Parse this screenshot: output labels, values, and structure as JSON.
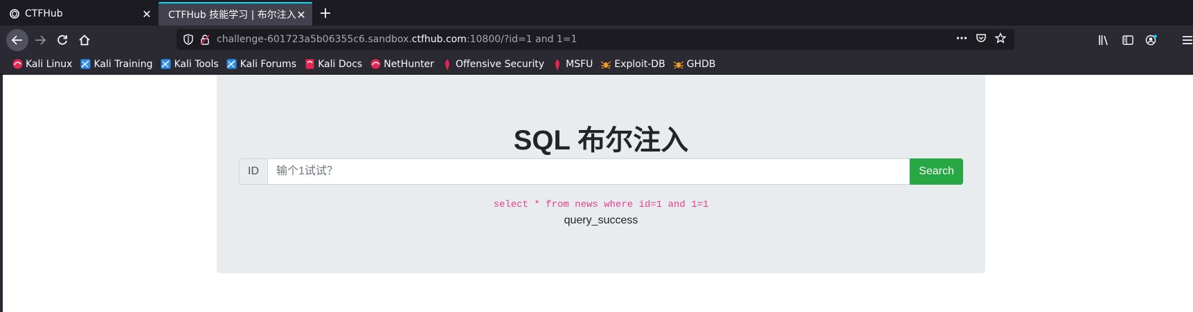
{
  "browser": {
    "tabs": [
      {
        "title": "CTFHub",
        "active": false,
        "favicon": "ctfhub-icon"
      },
      {
        "title": "CTFHub 技能学习 | 布尔注入",
        "active": true,
        "favicon": "none"
      }
    ],
    "url": {
      "prefix": "challenge-601723a5b06355c6.sandbox.",
      "domain": "ctfhub.com",
      "suffix": ":10800/?id=1 and 1=1"
    },
    "bookmarks": [
      {
        "label": "Kali Linux",
        "icon": "kali-icon"
      },
      {
        "label": "Kali Training",
        "icon": "kali-training-icon"
      },
      {
        "label": "Kali Tools",
        "icon": "kali-tools-icon"
      },
      {
        "label": "Kali Forums",
        "icon": "kali-forums-icon"
      },
      {
        "label": "Kali Docs",
        "icon": "kali-docs-icon"
      },
      {
        "label": "NetHunter",
        "icon": "nethunter-icon"
      },
      {
        "label": "Offensive Security",
        "icon": "offsec-icon"
      },
      {
        "label": "MSFU",
        "icon": "offsec-icon"
      },
      {
        "label": "Exploit-DB",
        "icon": "exploitdb-icon"
      },
      {
        "label": "GHDB",
        "icon": "exploitdb-icon"
      }
    ]
  },
  "page": {
    "heading": "SQL 布尔注入",
    "id_label": "ID",
    "input_placeholder": "输个1试试？",
    "input_value": "",
    "search_button": "Search",
    "sql": "select * from news where id=1 and 1=1",
    "result": "query_success"
  },
  "colors": {
    "accent_tab": "#00ddff",
    "search_button": "#28a745",
    "sql_text": "#e83e8c"
  }
}
